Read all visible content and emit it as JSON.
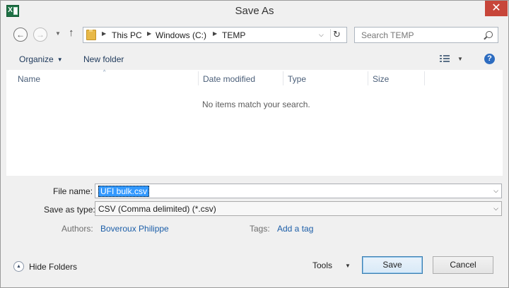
{
  "window": {
    "title": "Save As",
    "close_glyph": "✕"
  },
  "nav": {
    "back_glyph": "←",
    "forward_glyph": "→",
    "recent_glyph": "▼",
    "up_glyph": "↑",
    "breadcrumb": [
      "This PC",
      "Windows (C:)",
      "TEMP"
    ],
    "separator_glyph": "▶",
    "dropdown_glyph": "⌵",
    "refresh_glyph": "↻",
    "search_placeholder": "Search TEMP"
  },
  "commands": {
    "organize": "Organize",
    "caret": "▼",
    "new_folder": "New folder",
    "help_glyph": "?"
  },
  "filelist": {
    "sort_glyph": "^",
    "columns": [
      "Name",
      "Date modified",
      "Type",
      "Size"
    ],
    "empty_message": "No items match your search."
  },
  "form": {
    "file_name_label": "File name:",
    "file_name_value": "UFI bulk.csv",
    "save_type_label": "Save as type:",
    "save_type_value": "CSV (Comma delimited) (*.csv)",
    "authors_label": "Authors:",
    "authors_value": "Boveroux Philippe",
    "tags_label": "Tags:",
    "tags_value": "Add a tag",
    "dropdown_glyph": "⌵"
  },
  "footer": {
    "hide_folders": "Hide Folders",
    "hide_glyph": "▲",
    "tools": "Tools",
    "tools_caret": "▼",
    "save": "Save",
    "cancel": "Cancel"
  },
  "colors": {
    "accent": "#3399ff",
    "close_button": "#c7463a",
    "link": "#1c5ea8",
    "excel_green": "#1e7145"
  }
}
